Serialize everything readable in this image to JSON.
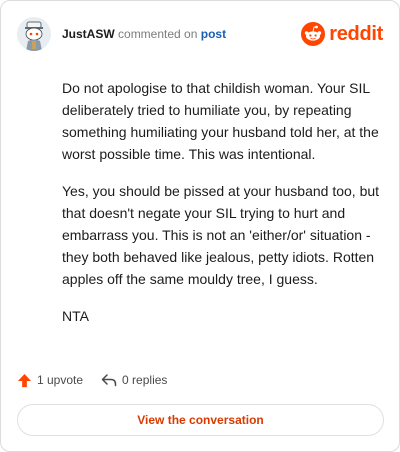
{
  "header": {
    "username": "JustASW",
    "action_text": "commented on",
    "post_link": "post",
    "brand": "reddit"
  },
  "comment": {
    "paragraphs": [
      "Do not apologise to that childish woman. Your SIL deliberately tried to humiliate you, by repeating something humiliating your husband told her, at the worst possible time. This was intentional.",
      "Yes, you should be pissed at your husband too, but that doesn't negate your SIL trying to hurt and embarrass you. This is not an 'either/or' situation - they both behaved like jealous, petty idiots. Rotten apples off the same mouldy tree, I guess.",
      "NTA"
    ]
  },
  "footer": {
    "upvotes": "1 upvote",
    "replies": "0 replies",
    "cta": "View the conversation"
  },
  "colors": {
    "brand": "#ff4500",
    "upvote": "#ff4500",
    "link": "#1a5fb4",
    "cta_text": "#d93a00"
  },
  "icons": {
    "avatar": "snoo-avatar-icon",
    "logo": "reddit-logo-icon",
    "upvote": "upvote-arrow-icon",
    "reply": "reply-arrow-icon"
  }
}
